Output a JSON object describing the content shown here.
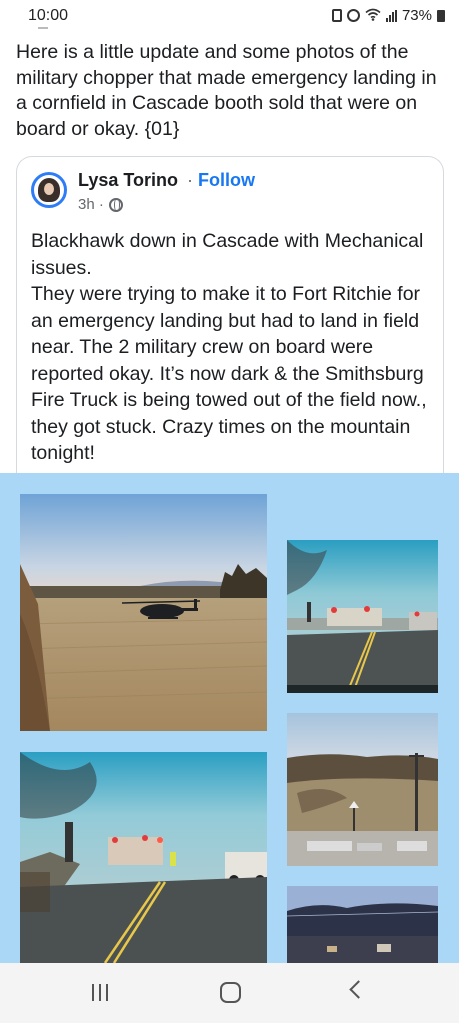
{
  "status_bar": {
    "time": "10:00",
    "battery": "73%",
    "icons": [
      "lock-icon",
      "alarm-icon",
      "wifi-icon",
      "signal-icon",
      "battery-icon"
    ]
  },
  "post": {
    "text": "Here is a little update and some photos of the military chopper that made emergency landing in a cornfield in Cascade booth sold that were on board or okay. {01}"
  },
  "shared_post": {
    "author": "Lysa Torino",
    "separator": "·",
    "follow_label": "Follow",
    "time": "3h ·",
    "body": "Blackhawk down in Cascade with Mechanical issues.\nThey were trying to make it to Fort Ritchie for an emergency landing but had to land in field near. The 2 military crew on board were reported okay. It’s now dark & the Smithsburg Fire Truck is being towed out of the field now., they got stuck. Crazy times on the mountain tonight!"
  },
  "photos": [
    "helicopter-in-field-photo",
    "foggy-road-fire-trucks-photo",
    "foggy-road-emergency-vehicles-photo",
    "farm-hillside-photo",
    "dusk-treeline-photo"
  ],
  "colors": {
    "link_blue": "#1877f2",
    "photo_background": "#a9d7f5",
    "avatar_ring": "#2e7df6",
    "nav_bar": "#f4f4f4"
  },
  "nav_bar": {
    "buttons": [
      "recent-apps-button",
      "home-button",
      "back-button"
    ]
  }
}
